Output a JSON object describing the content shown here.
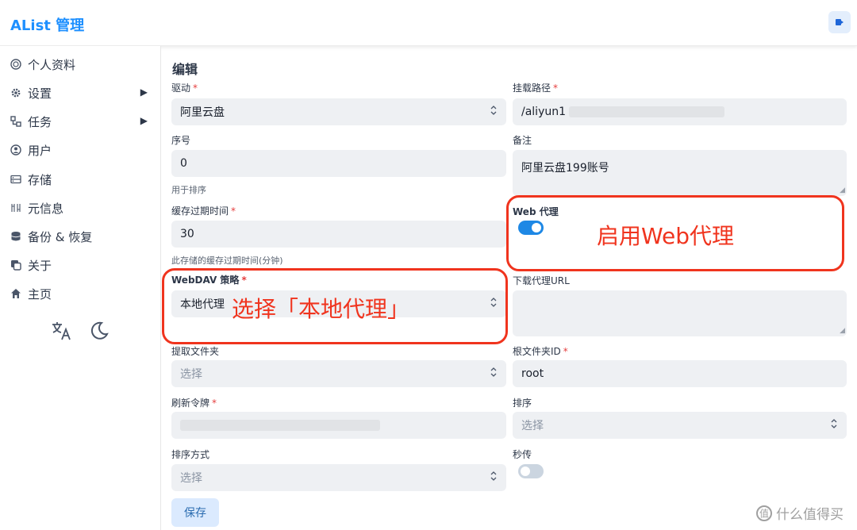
{
  "header": {
    "brand": "AList 管理"
  },
  "sidebar": {
    "items": [
      {
        "label": "个人资料",
        "icon": "fingerprint-icon",
        "arrow": false
      },
      {
        "label": "设置",
        "icon": "gear-icon",
        "arrow": true
      },
      {
        "label": "任务",
        "icon": "task-icon",
        "arrow": true
      },
      {
        "label": "用户",
        "icon": "user-circle-icon",
        "arrow": false
      },
      {
        "label": "存储",
        "icon": "database-icon",
        "arrow": false
      },
      {
        "label": "元信息",
        "icon": "meta-icon",
        "arrow": false
      },
      {
        "label": "备份 & 恢复",
        "icon": "backup-icon",
        "arrow": false
      },
      {
        "label": "关于",
        "icon": "copy-icon",
        "arrow": false
      },
      {
        "label": "主页",
        "icon": "home-icon",
        "arrow": false
      }
    ]
  },
  "form": {
    "title": "编辑",
    "driver": {
      "label": "驱动",
      "value": "阿里云盘"
    },
    "mount_path": {
      "label": "挂载路径",
      "value": "/aliyun1"
    },
    "order": {
      "label": "序号",
      "value": "0",
      "help": "用于排序"
    },
    "remark": {
      "label": "备注",
      "value": "阿里云盘199账号"
    },
    "cache_expiration": {
      "label": "缓存过期时间",
      "value": "30",
      "help": "此存储的缓存过期时间(分钟)"
    },
    "web_proxy": {
      "label": "Web 代理",
      "on": true
    },
    "webdav_policy": {
      "label": "WebDAV 策略",
      "value": "本地代理"
    },
    "download_proxy_url": {
      "label": "下载代理URL",
      "value": ""
    },
    "extract_folder": {
      "label": "提取文件夹",
      "placeholder": "选择"
    },
    "root_folder_id": {
      "label": "根文件夹ID",
      "value": "root"
    },
    "refresh_token": {
      "label": "刷新令牌",
      "value": ""
    },
    "order_by": {
      "label": "排序",
      "placeholder": "选择"
    },
    "order_direction": {
      "label": "排序方式",
      "placeholder": "选择"
    },
    "rapid_upload": {
      "label": "秒传",
      "on": false
    },
    "save_label": "保存"
  },
  "annotations": {
    "web_proxy_note": "启用Web代理",
    "webdav_note": "选择「本地代理」",
    "color": "#f0341e"
  },
  "watermark": "什么值得买",
  "colors": {
    "accent": "#1e90ff",
    "toggle_on": "#1e88e5",
    "toggle_off": "#cbd5e0"
  }
}
